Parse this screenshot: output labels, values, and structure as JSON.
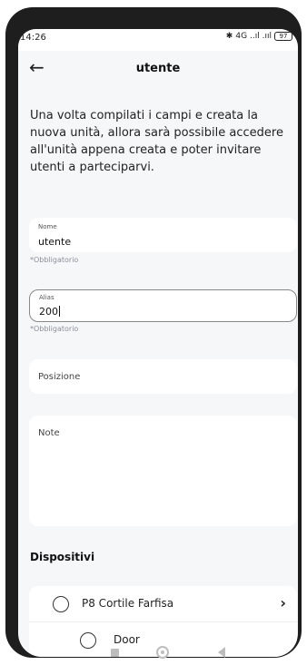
{
  "status_bar": {
    "time": "14:26",
    "bluetooth": "✱",
    "network": "4G",
    "signal": "..ıl .ııl",
    "battery": "97"
  },
  "app_bar": {
    "back_icon": "arrow-left-icon",
    "title": "utente"
  },
  "description": "Una volta compilati i campi e creata la nuova unità, allora sarà possibile accedere all'unità appena creata e poter invitare utenti a parteciparvi.",
  "form": {
    "nome": {
      "label": "Nome",
      "value": "utente",
      "helper": "*Obbligatorio"
    },
    "alias": {
      "label": "Alias",
      "value": "200",
      "helper": "*Obbligatorio"
    },
    "posizione": {
      "placeholder": "Posizione"
    },
    "note": {
      "placeholder": "Note"
    }
  },
  "devices": {
    "section_title": "Dispositivi",
    "items": [
      {
        "label": "P8 Cortile Farfisa",
        "selected": false,
        "icon": "chevron-right-icon"
      },
      {
        "label": "Door",
        "selected": false
      }
    ]
  },
  "colors": {
    "background": "#f6f7f9",
    "card": "#ffffff",
    "helper": "#8a8f99",
    "frame": "#1e1e1e"
  }
}
